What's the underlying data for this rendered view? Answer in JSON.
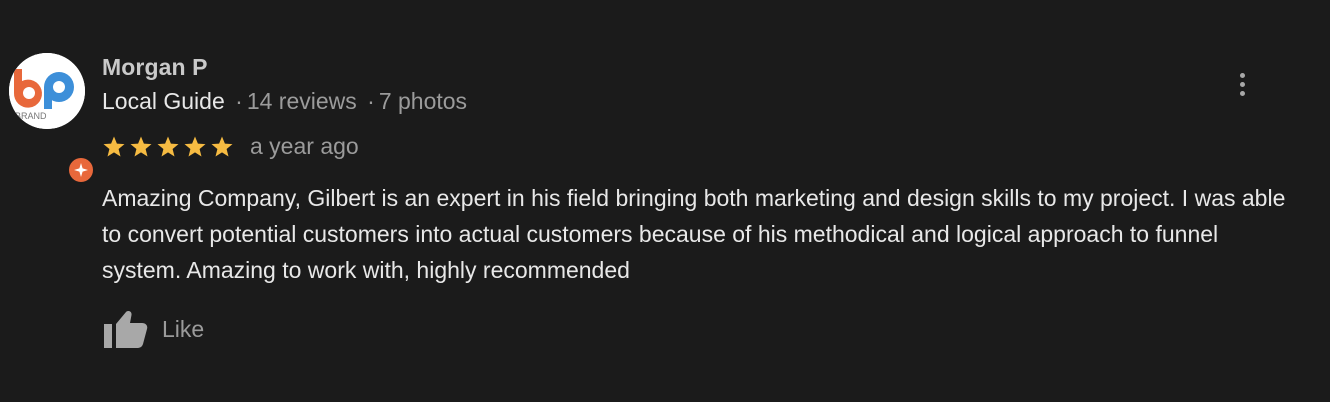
{
  "reviewer": {
    "name": "Morgan P",
    "badge": "Local Guide",
    "reviews": "14 reviews",
    "photos": "7 photos",
    "separator": "·",
    "avatar_icon": "brand-logo-avatar",
    "avatar_text": "BRAND"
  },
  "rating": {
    "stars": 5,
    "max": 5,
    "star_color": "#f6bb42",
    "time": "a year ago"
  },
  "review": {
    "text": "Amazing Company, Gilbert is an expert in his field bringing both marketing and design skills to my project. I was able to convert potential customers into actual customers because of his methodical and logical approach to funnel system. Amazing to work with, highly recommended"
  },
  "actions": {
    "like_label": "Like",
    "like_icon": "thumbs-up-icon",
    "more_icon": "more-vertical-icon"
  },
  "colors": {
    "background": "#1b1b1b",
    "text_primary": "#e8e8e8",
    "text_secondary": "#9b9b9b",
    "accent_orange": "#e8683b",
    "accent_blue": "#3d8fd9"
  }
}
